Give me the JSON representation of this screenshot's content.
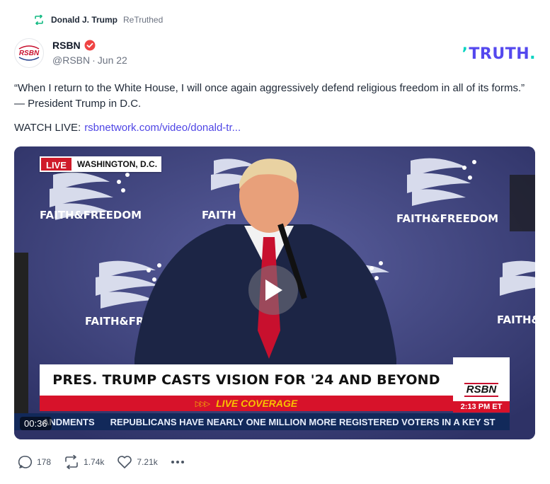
{
  "retruth": {
    "name": "Donald J. Trump",
    "tag": "ReTruthed"
  },
  "post": {
    "author_name": "RSBN",
    "author_handle": "@RSBN",
    "date": "Jun 22",
    "text": "“When I return to the White House, I will once again aggressively defend religious freedom in all of its forms.” — President Trump in D.C.",
    "watch_label": "WATCH LIVE:",
    "link_text": "rsbnetwork.com/video/donald-tr..."
  },
  "brand": {
    "logo_text": "TRUTH",
    "accent": "#5448ee",
    "teal": "#00d3c0"
  },
  "video": {
    "live_label": "LIVE",
    "location": "WASHINGTON, D.C.",
    "headline": "PRES. TRUMP CASTS VISION FOR '24 AND BEYOND",
    "coverage": "LIVE COVERAGE",
    "coverage_arrows": "▷▷▷",
    "station": "RSBN",
    "time": "2:13 PM ET",
    "ticker_left": "ANDMENTS",
    "ticker_right": "REPUBLICANS HAVE NEARLY ONE MILLION MORE REGISTERED VOTERS IN A KEY ST",
    "timestamp": "00:36",
    "backdrop_text": "FAITH & FREEDOM"
  },
  "actions": {
    "replies": "178",
    "retruths": "1.74k",
    "likes": "7.21k"
  }
}
